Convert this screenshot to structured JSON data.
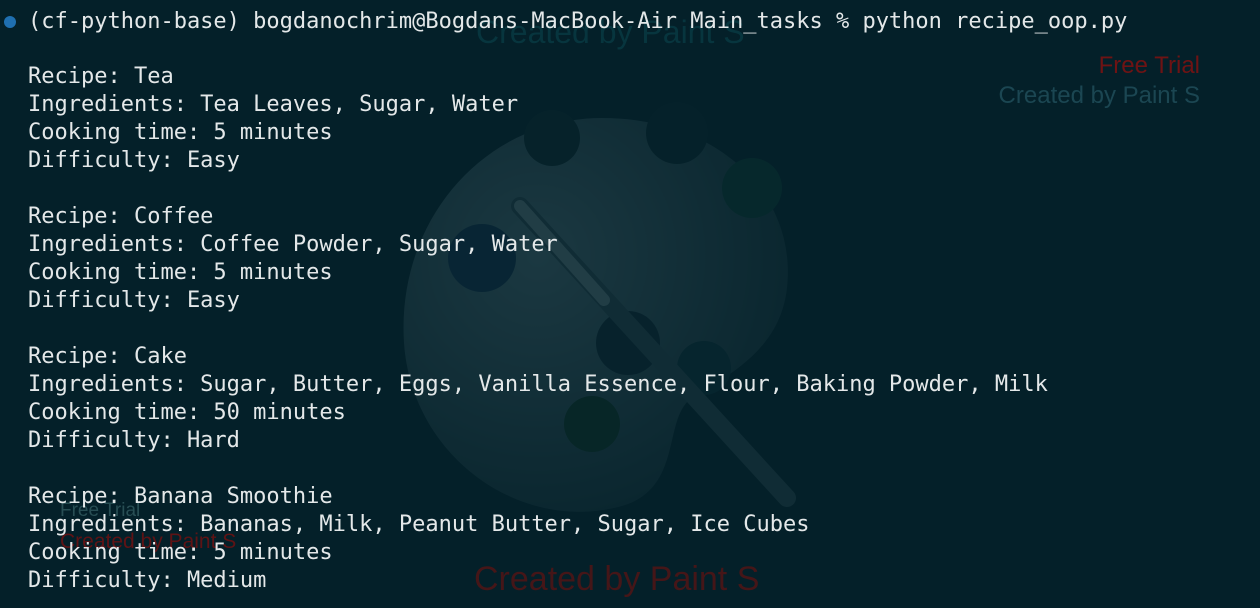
{
  "terminal": {
    "prompt_dot_color": "#1f6fb0",
    "command_line": "(cf-python-base) bogdanochrim@Bogdans-MacBook-Air Main_tasks % python recipe_oop.py",
    "background_color": "#042029"
  },
  "recipes": [
    {
      "recipe": "Recipe: Tea",
      "ingredients": "Ingredients: Tea Leaves, Sugar, Water",
      "cooking_time": "Cooking time: 5 minutes",
      "difficulty": "Difficulty: Easy"
    },
    {
      "recipe": "Recipe: Coffee",
      "ingredients": "Ingredients: Coffee Powder, Sugar, Water",
      "cooking_time": "Cooking time: 5 minutes",
      "difficulty": "Difficulty: Easy"
    },
    {
      "recipe": "Recipe: Cake",
      "ingredients": "Ingredients: Sugar, Butter, Eggs, Vanilla Essence, Flour, Baking Powder, Milk",
      "cooking_time": "Cooking time: 50 minutes",
      "difficulty": "Difficulty: Hard"
    },
    {
      "recipe": "Recipe: Banana Smoothie",
      "ingredients": "Ingredients: Bananas, Milk, Peanut Butter, Sugar, Ice Cubes",
      "cooking_time": "Cooking time: 5 minutes",
      "difficulty": "Difficulty: Medium"
    }
  ],
  "watermark": {
    "top_text": "Created by Paint S",
    "right_trial": "Free Trial",
    "right_created": "Created by Paint S",
    "left_trial": "Free Trial",
    "left_created": "Created by Paint S",
    "bottom_text": "Created by Paint S",
    "icon": "palette-icon"
  }
}
